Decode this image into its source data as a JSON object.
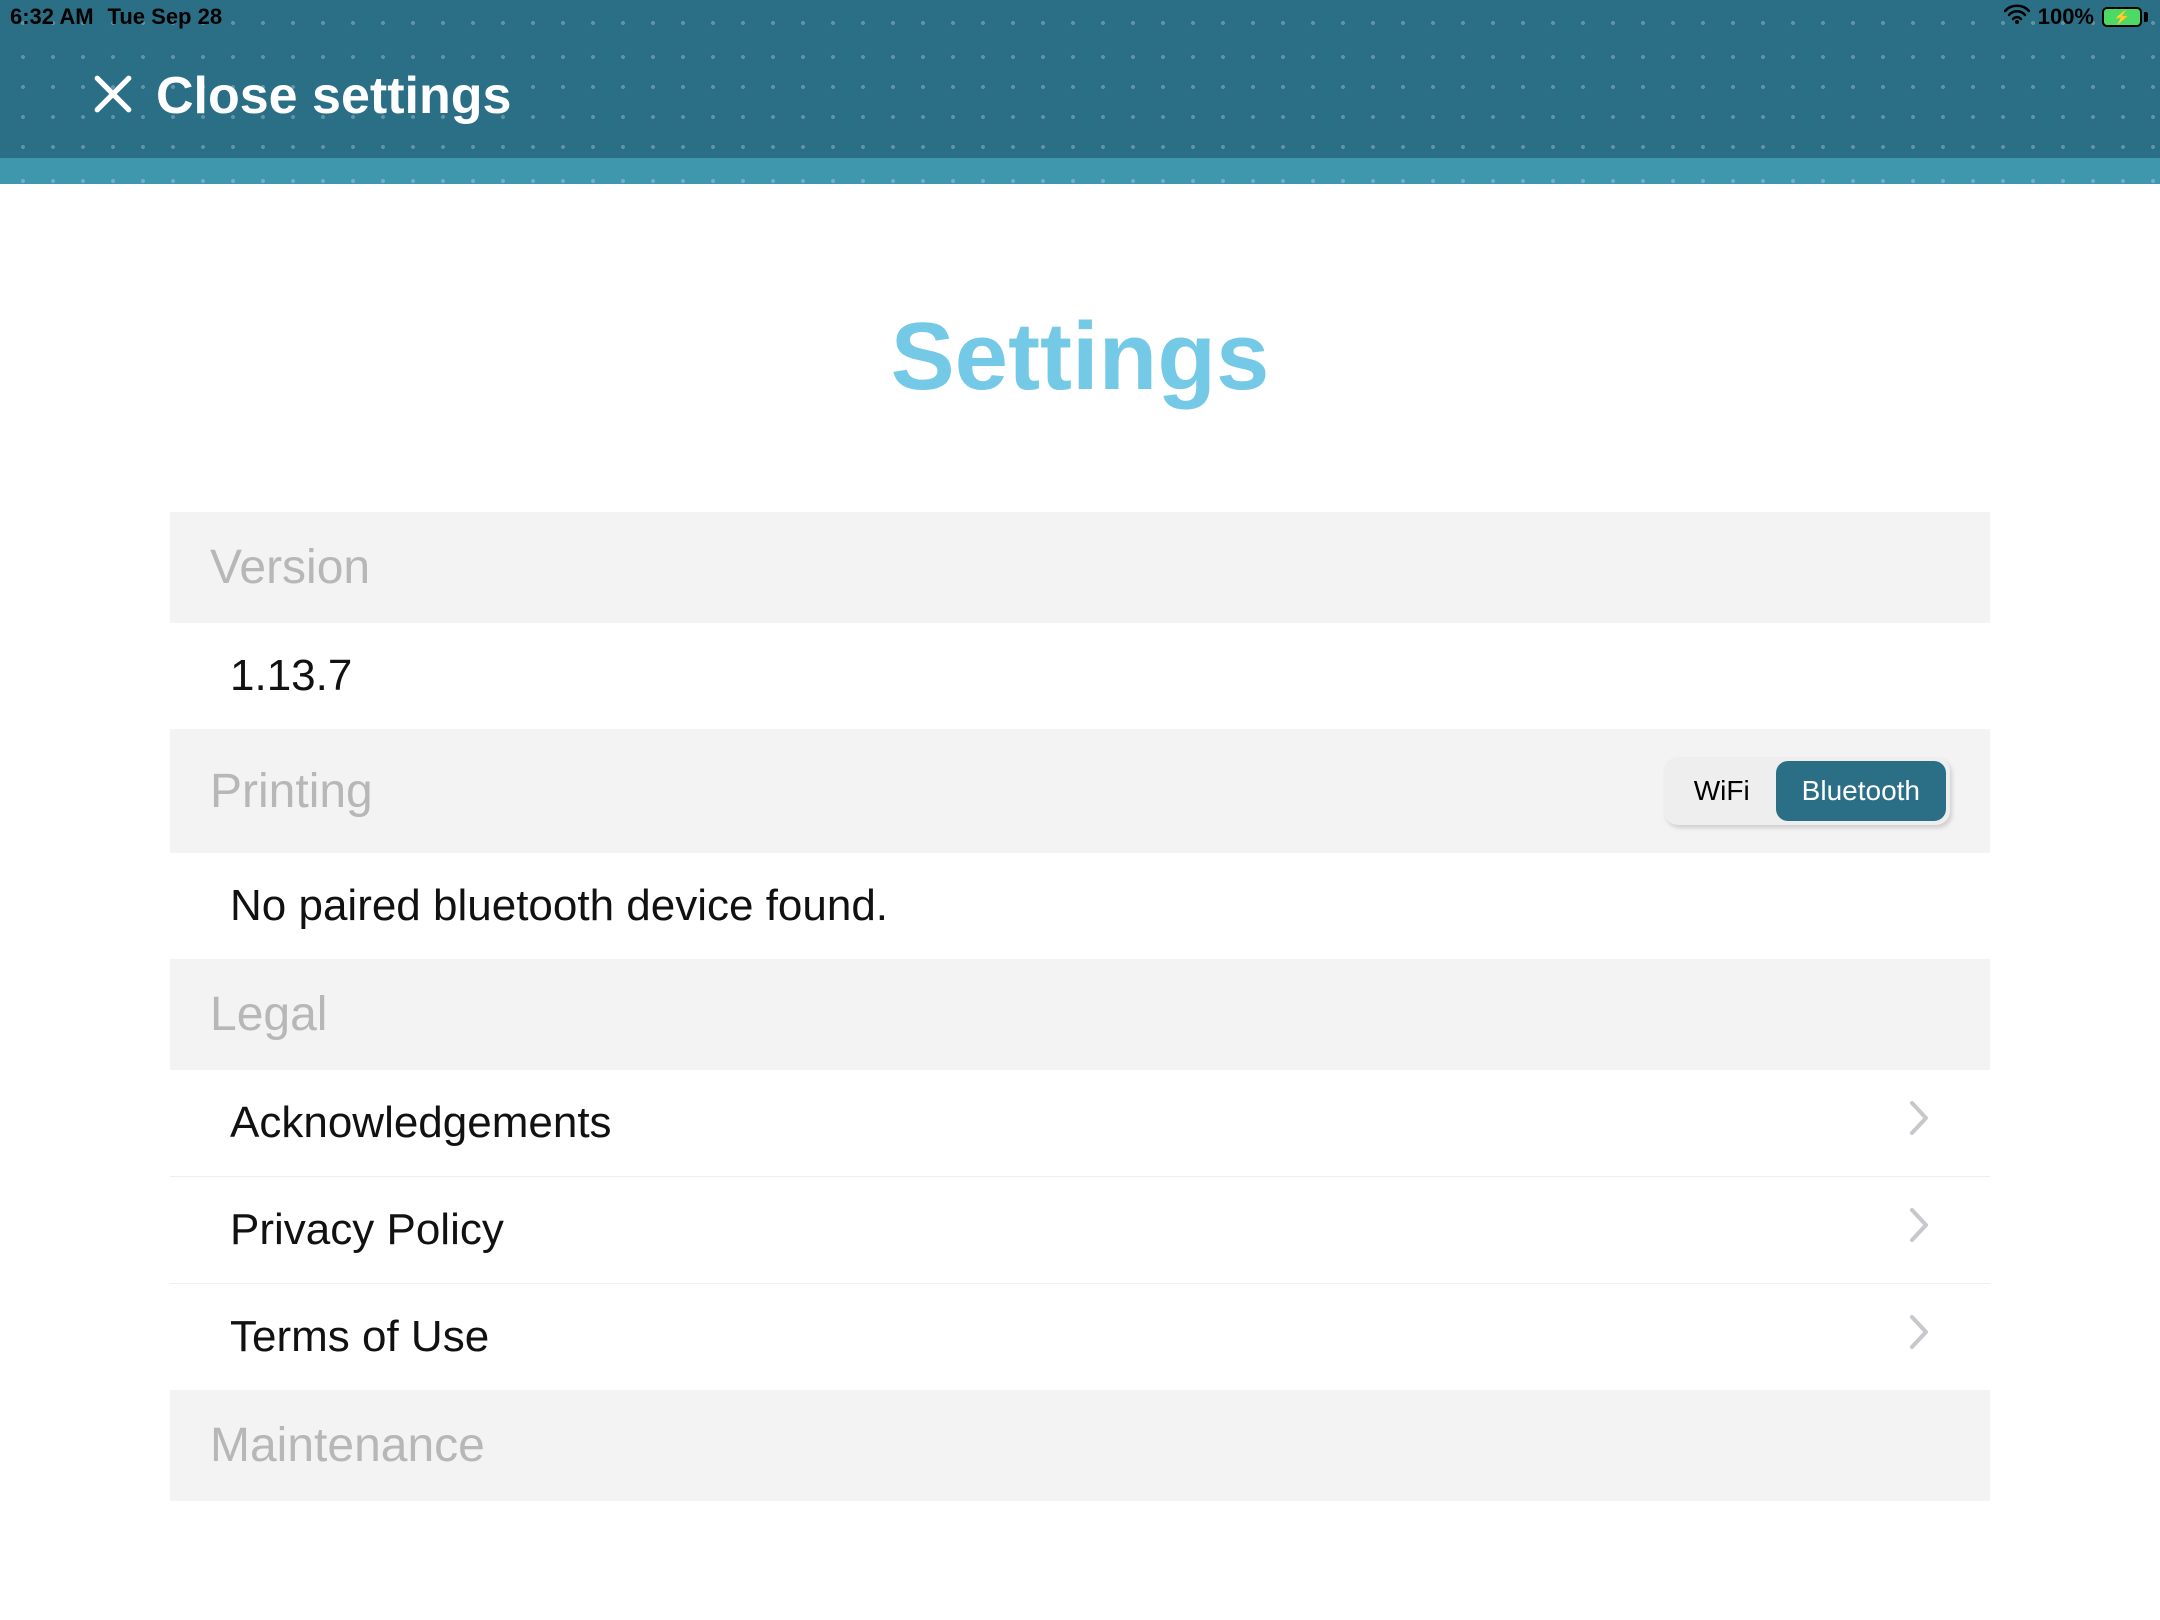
{
  "status": {
    "time": "6:32 AM",
    "date": "Tue Sep 28",
    "battery_pct": "100%"
  },
  "header": {
    "close_label": "Close settings"
  },
  "page": {
    "title": "Settings"
  },
  "sections": {
    "version": {
      "header": "Version",
      "value": "1.13.7"
    },
    "printing": {
      "header": "Printing",
      "segments": {
        "wifi": "WiFi",
        "bluetooth": "Bluetooth"
      },
      "selected": "bluetooth",
      "status_text": "No paired bluetooth device found."
    },
    "legal": {
      "header": "Legal",
      "items": [
        {
          "label": "Acknowledgements"
        },
        {
          "label": "Privacy Policy"
        },
        {
          "label": "Terms of Use"
        }
      ]
    },
    "maintenance": {
      "header": "Maintenance"
    }
  }
}
